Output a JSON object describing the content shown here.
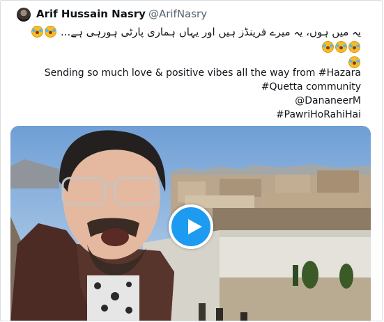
{
  "tweet": {
    "author_name": "Arif Hussain Nasry",
    "author_handle": "@ArifNasry",
    "urdu_text": "یہ میں ہوں، یہ میرے فرینڈز ہیں اور یہاں ہماری پارٹی ہورہی ہے...",
    "emoji_icon": "face-with-tears-of-joy-icon",
    "emoji_count_line1": 5,
    "emoji_count_line2": 1,
    "english_line1": "Sending so much love & positive vibes all the way from #Hazara",
    "english_line2": "#Quetta community",
    "english_line3": "@DananeerM",
    "english_line4": "#PawriHoRahiHai"
  },
  "colors": {
    "name": "#0f1419",
    "handle": "#536471",
    "play_button": "#1d9bf0",
    "card_border": "#d9dee3"
  }
}
